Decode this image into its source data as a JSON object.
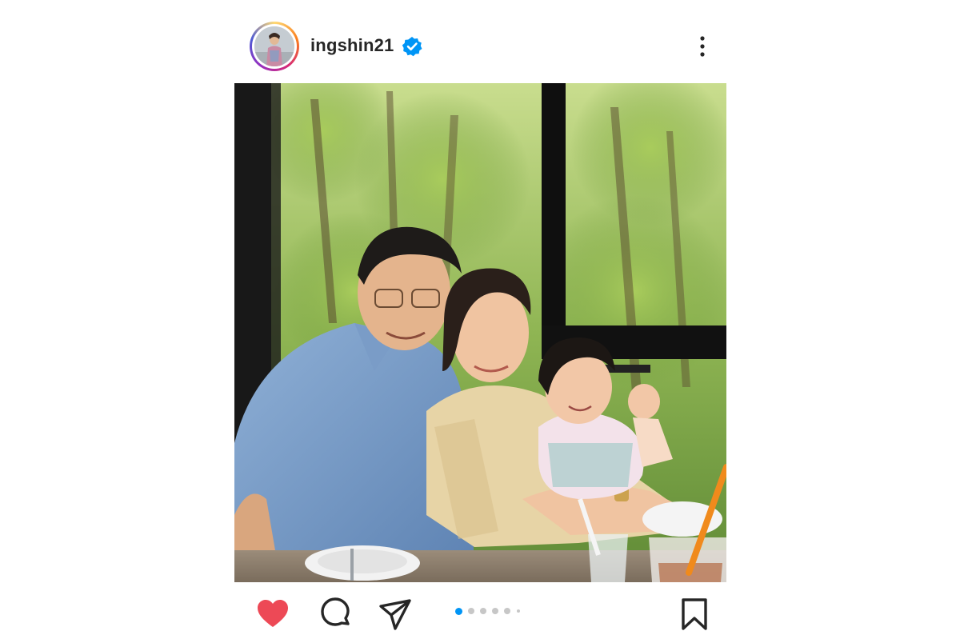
{
  "post": {
    "username": "ingshin21",
    "verified": true,
    "avatar": "profile-photo",
    "more_icon": "more-vertical-icon"
  },
  "media": {
    "description_alt": "photo",
    "carousel": {
      "total": 5,
      "active_index": 0
    }
  },
  "actions": {
    "like": {
      "icon": "heart-filled-icon",
      "liked": true,
      "color": "#ed4956"
    },
    "comment": {
      "icon": "comment-icon"
    },
    "share": {
      "icon": "send-icon"
    },
    "save": {
      "icon": "bookmark-icon"
    }
  },
  "colors": {
    "accent_blue": "#0095f6",
    "like_red": "#ed4956",
    "text": "#262626"
  }
}
